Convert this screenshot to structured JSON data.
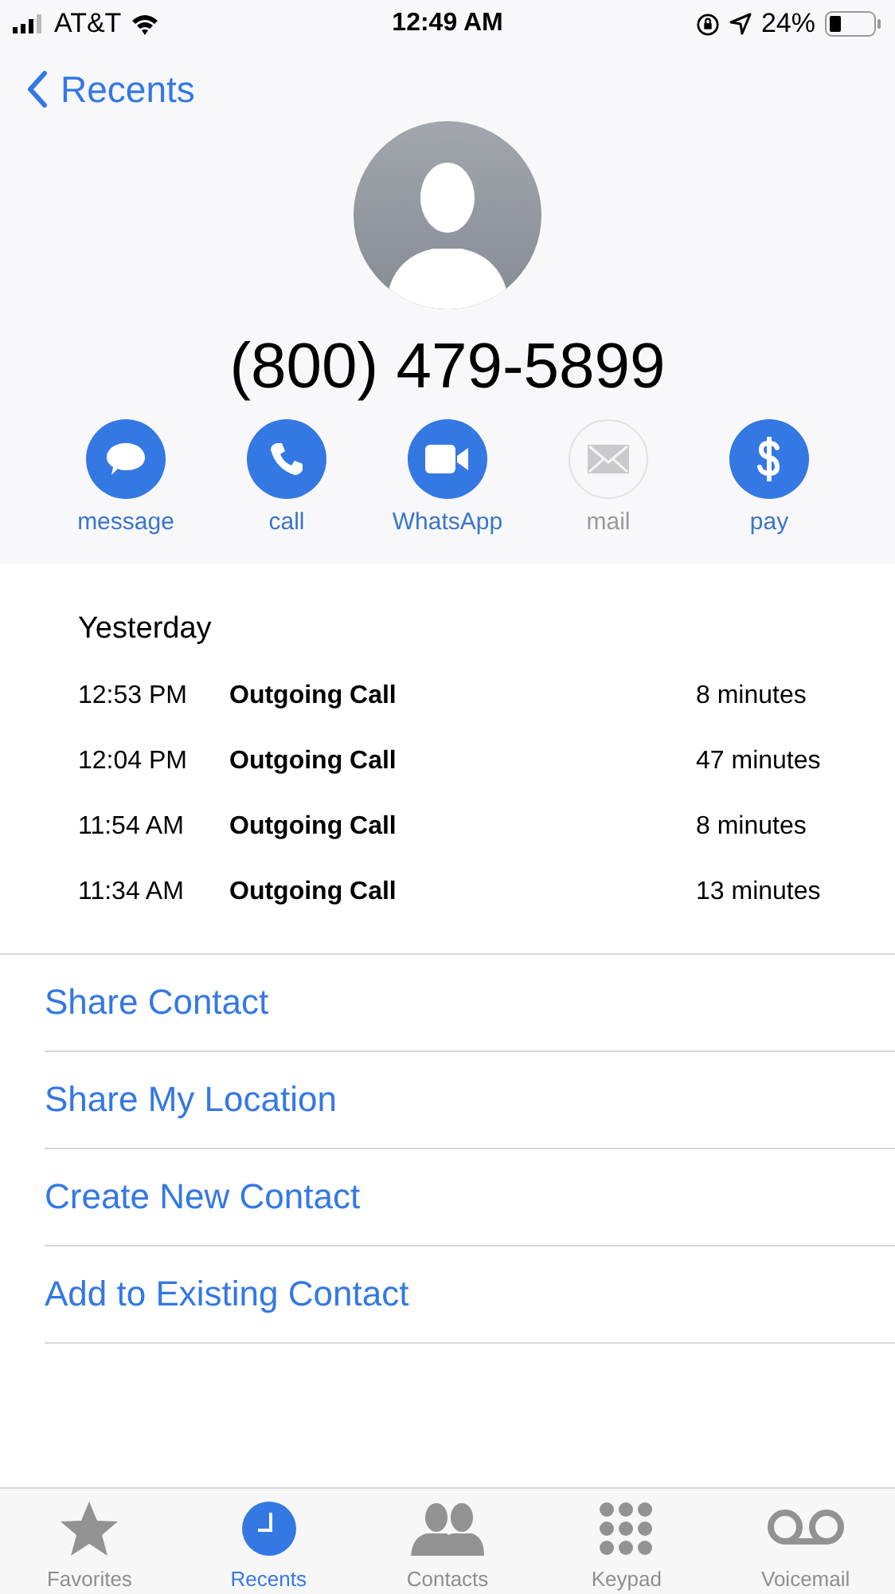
{
  "status_bar": {
    "carrier": "AT&T",
    "time": "12:49 AM",
    "battery": "24%"
  },
  "nav": {
    "back": "Recents"
  },
  "contact": {
    "number": "(800) 479-5899"
  },
  "actions": [
    {
      "kind": "message",
      "label": "message",
      "disabled": false
    },
    {
      "kind": "call",
      "label": "call",
      "disabled": false
    },
    {
      "kind": "video",
      "label": "WhatsApp",
      "disabled": false
    },
    {
      "kind": "mail",
      "label": "mail",
      "disabled": true
    },
    {
      "kind": "pay",
      "label": "pay",
      "disabled": false
    }
  ],
  "call_log": {
    "heading": "Yesterday",
    "rows": [
      {
        "time": "12:53 PM",
        "type": "Outgoing Call",
        "duration": "8 minutes"
      },
      {
        "time": "12:04 PM",
        "type": "Outgoing Call",
        "duration": "47 minutes"
      },
      {
        "time": "11:54 AM",
        "type": "Outgoing Call",
        "duration": "8 minutes"
      },
      {
        "time": "11:34 AM",
        "type": "Outgoing Call",
        "duration": "13 minutes"
      }
    ]
  },
  "options": [
    "Share Contact",
    "Share My Location",
    "Create New Contact",
    "Add to Existing Contact"
  ],
  "tabs": [
    {
      "kind": "favorites",
      "label": "Favorites",
      "selected": false
    },
    {
      "kind": "recents",
      "label": "Recents",
      "selected": true
    },
    {
      "kind": "contacts",
      "label": "Contacts",
      "selected": false
    },
    {
      "kind": "keypad",
      "label": "Keypad",
      "selected": false
    },
    {
      "kind": "voicemail",
      "label": "Voicemail",
      "selected": false
    }
  ]
}
